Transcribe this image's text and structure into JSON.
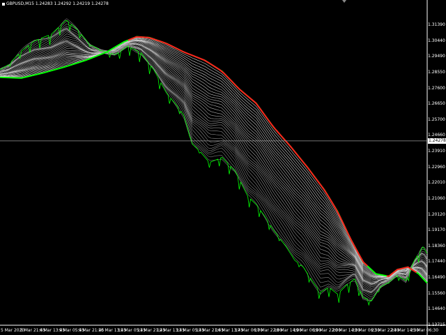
{
  "window": {
    "symbol_info": "GBPUSD,M15 1.24283 1.24292 1.24219 1.24278",
    "current_price": "1.24278"
  },
  "price_axis": {
    "labels": [
      "1.31390",
      "1.30440",
      "1.29490",
      "1.28550",
      "1.27600",
      "1.26650",
      "1.25700",
      "1.24660",
      "1.23910",
      "1.22960",
      "1.22010",
      "1.21060",
      "1.20120",
      "1.19170",
      "1.18360",
      "1.17440",
      "1.16490",
      "1.15560",
      "1.14640",
      "1.13715"
    ]
  },
  "time_axis": {
    "labels": [
      "5 Mar 2020",
      "5 Mar 21:45",
      "6 Mar 13:45",
      "9 Mar 05:45",
      "9 Mar 21:45",
      "10 Mar 13:45",
      "11 Mar 05:45",
      "11 Mar 21:45",
      "12 Mar 13:45",
      "13 Mar 05:45",
      "13 Mar 21:45",
      "16 Mar 13:45",
      "17 Mar 06:00",
      "17 Mar 22:00",
      "18 Mar 14:00",
      "19 Mar 06:00",
      "19 Mar 22:00",
      "20 Mar 14:00",
      "23 Mar 06:30",
      "23 Mar 22:30",
      "24 Mar 14:30",
      "25 Mar 06:30"
    ]
  },
  "chart_data": {
    "type": "line",
    "ylim": [
      1.136,
      1.323
    ],
    "x_range": [
      0,
      1
    ],
    "colors": {
      "rise": "#00ff00",
      "fall": "#ff2020",
      "fan": "#ffffff",
      "crosshair": "#999999"
    },
    "trend_line": [
      {
        "x": 0.0,
        "y": 1.2805
      },
      {
        "x": 0.05,
        "y": 1.28
      },
      {
        "x": 0.1,
        "y": 1.283
      },
      {
        "x": 0.15,
        "y": 1.2865
      },
      {
        "x": 0.2,
        "y": 1.2905
      },
      {
        "x": 0.25,
        "y": 1.2955
      },
      {
        "x": 0.29,
        "y": 1.3015
      },
      {
        "x": 0.32,
        "y": 1.3045
      },
      {
        "x": 0.35,
        "y": 1.304
      },
      {
        "x": 0.39,
        "y": 1.3005
      },
      {
        "x": 0.43,
        "y": 1.2955
      },
      {
        "x": 0.48,
        "y": 1.2905
      },
      {
        "x": 0.52,
        "y": 1.284
      },
      {
        "x": 0.56,
        "y": 1.2735
      },
      {
        "x": 0.6,
        "y": 1.265
      },
      {
        "x": 0.64,
        "y": 1.251
      },
      {
        "x": 0.68,
        "y": 1.2395
      },
      {
        "x": 0.72,
        "y": 1.227
      },
      {
        "x": 0.76,
        "y": 1.2135
      },
      {
        "x": 0.79,
        "y": 1.201
      },
      {
        "x": 0.82,
        "y": 1.185
      },
      {
        "x": 0.85,
        "y": 1.171
      },
      {
        "x": 0.88,
        "y": 1.164
      },
      {
        "x": 0.91,
        "y": 1.1625
      },
      {
        "x": 0.93,
        "y": 1.1665
      },
      {
        "x": 0.955,
        "y": 1.168
      },
      {
        "x": 0.98,
        "y": 1.164
      },
      {
        "x": 1.0,
        "y": 1.1585
      }
    ],
    "fall_segments": [
      [
        0.3,
        0.86
      ],
      [
        0.905,
        0.975
      ]
    ],
    "price_path": [
      {
        "x": 0.0,
        "y": 1.285
      },
      {
        "x": 0.02,
        "y": 1.288
      },
      {
        "x": 0.05,
        "y": 1.296
      },
      {
        "x": 0.08,
        "y": 1.302
      },
      {
        "x": 0.12,
        "y": 1.306
      },
      {
        "x": 0.155,
        "y": 1.3145
      },
      {
        "x": 0.18,
        "y": 1.309
      },
      {
        "x": 0.21,
        "y": 1.3
      },
      {
        "x": 0.24,
        "y": 1.296
      },
      {
        "x": 0.27,
        "y": 1.294
      },
      {
        "x": 0.3,
        "y": 1.299
      },
      {
        "x": 0.33,
        "y": 1.295
      },
      {
        "x": 0.36,
        "y": 1.285
      },
      {
        "x": 0.39,
        "y": 1.271
      },
      {
        "x": 0.41,
        "y": 1.265
      },
      {
        "x": 0.43,
        "y": 1.258
      },
      {
        "x": 0.45,
        "y": 1.241
      },
      {
        "x": 0.47,
        "y": 1.236
      },
      {
        "x": 0.49,
        "y": 1.23
      },
      {
        "x": 0.52,
        "y": 1.233
      },
      {
        "x": 0.55,
        "y": 1.225
      },
      {
        "x": 0.58,
        "y": 1.21
      },
      {
        "x": 0.6,
        "y": 1.205
      },
      {
        "x": 0.62,
        "y": 1.198
      },
      {
        "x": 0.64,
        "y": 1.19
      },
      {
        "x": 0.67,
        "y": 1.18
      },
      {
        "x": 0.69,
        "y": 1.172
      },
      {
        "x": 0.71,
        "y": 1.168
      },
      {
        "x": 0.73,
        "y": 1.16
      },
      {
        "x": 0.75,
        "y": 1.153
      },
      {
        "x": 0.77,
        "y": 1.156
      },
      {
        "x": 0.79,
        "y": 1.152
      },
      {
        "x": 0.81,
        "y": 1.157
      },
      {
        "x": 0.83,
        "y": 1.161
      },
      {
        "x": 0.85,
        "y": 1.15
      },
      {
        "x": 0.87,
        "y": 1.148
      },
      {
        "x": 0.89,
        "y": 1.156
      },
      {
        "x": 0.91,
        "y": 1.159
      },
      {
        "x": 0.93,
        "y": 1.163
      },
      {
        "x": 0.95,
        "y": 1.16
      },
      {
        "x": 0.97,
        "y": 1.172
      },
      {
        "x": 0.99,
        "y": 1.18
      },
      {
        "x": 1.0,
        "y": 1.176
      }
    ]
  }
}
